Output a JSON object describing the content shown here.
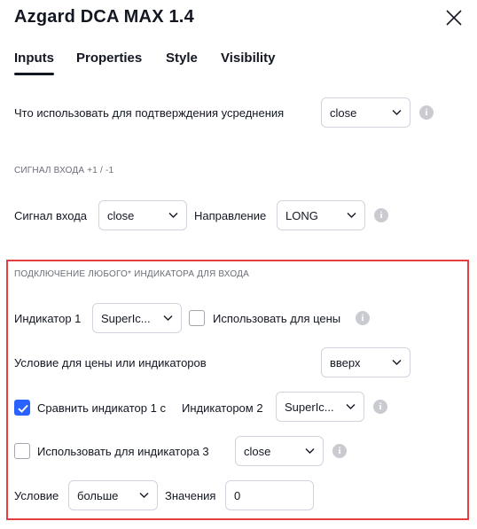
{
  "dialog": {
    "title": "Azgard DCA MAX 1.4",
    "tabs": [
      "Inputs",
      "Properties",
      "Style",
      "Visibility"
    ],
    "active_tab": "Inputs"
  },
  "confirm_row": {
    "label": "Что использовать для подтверждения усреднения",
    "select_value": "close"
  },
  "entry_signal": {
    "section_title": "СИГНАЛ ВХОДА +1 / -1",
    "signal_label": "Сигнал входа",
    "signal_value": "close",
    "direction_label": "Направление",
    "direction_value": "LONG"
  },
  "indicator_section": {
    "section_title": "ПОДКЛЮЧЕНИЕ ЛЮБОГО* ИНДИКАТОРА ДЛЯ ВХОДА",
    "indicator1_label": "Индикатор 1",
    "indicator1_value": "SuperIc...",
    "use_for_price_label": "Использовать для цены",
    "use_for_price_checked": false,
    "condition_label": "Условие для цены или индикаторов",
    "condition_value": "вверх",
    "compare_label": "Сравнить индикатор 1 с",
    "compare_checked": true,
    "indicator2_label": "Индикатором 2",
    "indicator2_value": "SuperIc...",
    "use_for_ind3_label": "Использовать для индикатора 3",
    "use_for_ind3_checked": false,
    "ind3_value": "close",
    "cond2_label": "Условие",
    "cond2_value": "больше",
    "values_label": "Значения",
    "values_value": "0"
  },
  "colors": {
    "accent": "#2962ff",
    "highlight": "#e53e43",
    "text": "#131722",
    "border": "#d1d4dc"
  },
  "icons": [
    "close-icon",
    "chevron-down-icon",
    "info-icon",
    "checkmark-icon"
  ]
}
